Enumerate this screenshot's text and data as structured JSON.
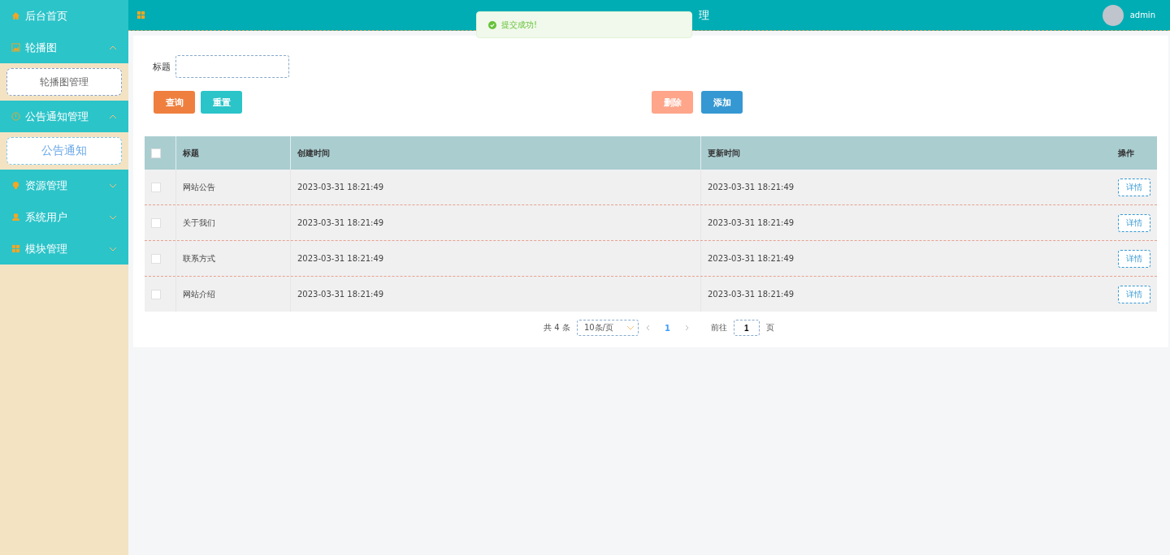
{
  "sidebar": {
    "items": [
      {
        "label": "后台首页",
        "kind": "link"
      },
      {
        "label": "轮播图",
        "kind": "group",
        "expanded": true,
        "children": [
          {
            "label": "轮播图管理",
            "selected": false
          }
        ]
      },
      {
        "label": "公告通知管理",
        "kind": "group",
        "expanded": true,
        "children": [
          {
            "label": "公告通知",
            "selected": true
          }
        ]
      },
      {
        "label": "资源管理",
        "kind": "group",
        "expanded": false
      },
      {
        "label": "系统用户",
        "kind": "group",
        "expanded": false
      },
      {
        "label": "模块管理",
        "kind": "group",
        "expanded": false
      }
    ]
  },
  "header": {
    "title_visible": "理",
    "user": "admin"
  },
  "toast": {
    "message": "提交成功!"
  },
  "search": {
    "label": "标题"
  },
  "buttons": [
    {
      "label": "查询",
      "kind": "query"
    },
    {
      "label": "重置",
      "kind": "reset"
    },
    {
      "label": "删除",
      "kind": "delete"
    },
    {
      "label": "添加",
      "kind": "add"
    }
  ],
  "table": {
    "select_all": false,
    "columns": [
      "标题",
      "创建时间",
      "更新时间",
      "操作"
    ],
    "rows": [
      {
        "checked": false,
        "title": "网站公告",
        "created": "2023-03-31 18:21:49",
        "updated": "2023-03-31 18:21:49",
        "action": "详情"
      },
      {
        "checked": false,
        "title": "关于我们",
        "created": "2023-03-31 18:21:49",
        "updated": "2023-03-31 18:21:49",
        "action": "详情"
      },
      {
        "checked": false,
        "title": "联系方式",
        "created": "2023-03-31 18:21:49",
        "updated": "2023-03-31 18:21:49",
        "action": "详情"
      },
      {
        "checked": false,
        "title": "网站介绍",
        "created": "2023-03-31 18:21:49",
        "updated": "2023-03-31 18:21:49",
        "action": "详情"
      }
    ]
  },
  "pagination": {
    "total": "共 4 条",
    "page_size": "10条/页",
    "pages": [
      {
        "label": "1",
        "selected": true
      }
    ],
    "goto_label": "前往",
    "goto_value": "1",
    "goto_suffix": "页"
  }
}
